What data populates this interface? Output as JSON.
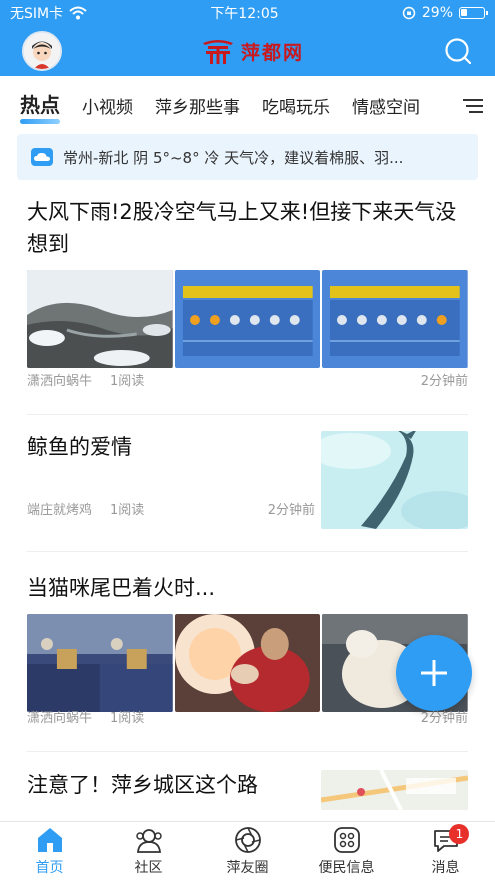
{
  "status": {
    "carrier": "无SIM卡",
    "time": "下午12:05",
    "battery": "29%"
  },
  "header": {
    "logo_text": "萍都网"
  },
  "tabs": [
    {
      "label": "热点"
    },
    {
      "label": "小视频"
    },
    {
      "label": "萍乡那些事"
    },
    {
      "label": "吃喝玩乐"
    },
    {
      "label": "情感空间"
    }
  ],
  "weather": {
    "text": "常州-新北 阴 5°~8° 冷 天气冷，建议着棉服、羽..."
  },
  "articles": [
    {
      "title": "大风下雨!2股冷空气马上又来!但接下来天气没想到",
      "source": "潇洒向蜗牛",
      "reads": "1阅读",
      "time": "2分钟前"
    },
    {
      "title": "鲸鱼的爱情",
      "source": "端庄就烤鸡",
      "reads": "1阅读",
      "time": "2分钟前"
    },
    {
      "title": "当猫咪尾巴着火时...",
      "source": "潇洒向蜗牛",
      "reads": "1阅读",
      "time": "2分钟前"
    },
    {
      "title": "注意了！萍乡城区这个路"
    }
  ],
  "bottom_nav": [
    {
      "label": "首页"
    },
    {
      "label": "社区"
    },
    {
      "label": "萍友圈"
    },
    {
      "label": "便民信息"
    },
    {
      "label": "消息",
      "badge": "1"
    }
  ],
  "colors": {
    "primary": "#2f9df4",
    "badge": "#e8302a",
    "logo": "#c8191f"
  }
}
